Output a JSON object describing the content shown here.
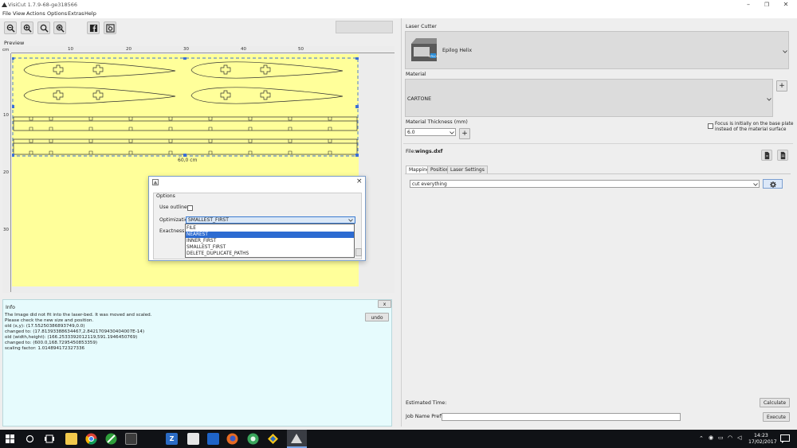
{
  "window": {
    "title": "VisiCut 1.7.9-68-ge318566",
    "minimize_glyph": "–",
    "maximize_glyph": "❐",
    "close_glyph": "✕"
  },
  "menu": [
    "File",
    "View",
    "Actions",
    "Options",
    "Extras",
    "Help"
  ],
  "toolbar": {
    "icons": [
      "zoom-out-icon",
      "zoom-in-icon",
      "zoom-fit-icon",
      "zoom-reset-icon",
      "facebook-icon",
      "camera-icon"
    ]
  },
  "preview": {
    "label": "Preview",
    "unit": "cm",
    "top_ticks": [
      "10",
      "20",
      "30",
      "40",
      "50"
    ],
    "left_ticks": [
      "10",
      "20",
      "30"
    ],
    "selection_width_label": "60,0 cm"
  },
  "options_dialog": {
    "group_label": "Options",
    "use_outline_label": "Use outline",
    "use_outline_checked": false,
    "optimization_label": "Optimization",
    "optimization_value": "SMALLEST_FIRST",
    "exactness_label": "Exactness",
    "close_glyph": "×",
    "dropdown_options": [
      "FILE",
      "NEAREST",
      "INNER_FIRST",
      "SMALLEST_FIRST",
      "DELETE_DUPLICATE_PATHS"
    ],
    "selected_option": "NEAREST"
  },
  "info": {
    "title": "Info",
    "close_label": "x",
    "undo_label": "undo",
    "lines": [
      "The Image did not fit into the laser-bed. It was moved and scaled.",
      "Please check the new size and position.",
      "old (x,y): (17.55250386893749,0.0)",
      "changed to: (17.81393388634467,2.8421709430404007E-14)",
      "old (width,height): (166.2533392012119,591.1946450769)",
      "changed to: (600.0,168.7295450853359)",
      "  scaling factor: 1.014894172327336"
    ]
  },
  "laser_cutter": {
    "section_label": "Laser Cutter",
    "device_name": "Epilog Helix",
    "device_badge": "EPILOG"
  },
  "material": {
    "section_label": "Material",
    "value": "CARTONE",
    "add_label": "+"
  },
  "thickness": {
    "label": "Material Thickness (mm)",
    "value": "6.0",
    "add_label": "+",
    "focus_checkbox_label_line1": "Focus is initially on the base plate",
    "focus_checkbox_label_line2": "instead of the material surface",
    "focus_checked": false
  },
  "file": {
    "label": "File:",
    "name": "wings.dxf"
  },
  "tabs": [
    "Mapping",
    "Position",
    "Laser Settings"
  ],
  "active_tab": "Mapping",
  "mapping": {
    "value": "cut everything"
  },
  "bottom": {
    "estimated_time_label": "Estimated Time:",
    "calculate_label": "Calculate",
    "job_name_label": "Job Name Prefix:",
    "job_name_value": "",
    "execute_label": "Execute"
  },
  "taskbar": {
    "time": "14:23",
    "date": "17/02/2017",
    "apps": [
      "start-icon",
      "search-icon",
      "task-view-icon",
      "file-explorer-icon",
      "chrome-icon",
      "tool-icon",
      "app-icon",
      "app-z-icon",
      "calculator-icon",
      "app-icon-2",
      "firefox-icon",
      "app-icon-3",
      "app-icon-4",
      "visicut-icon"
    ]
  },
  "colors": {
    "bed": "#ffff9a",
    "info_bg": "#e6fbfd",
    "selection": "#2c6bd1",
    "taskbar": "#101216"
  }
}
